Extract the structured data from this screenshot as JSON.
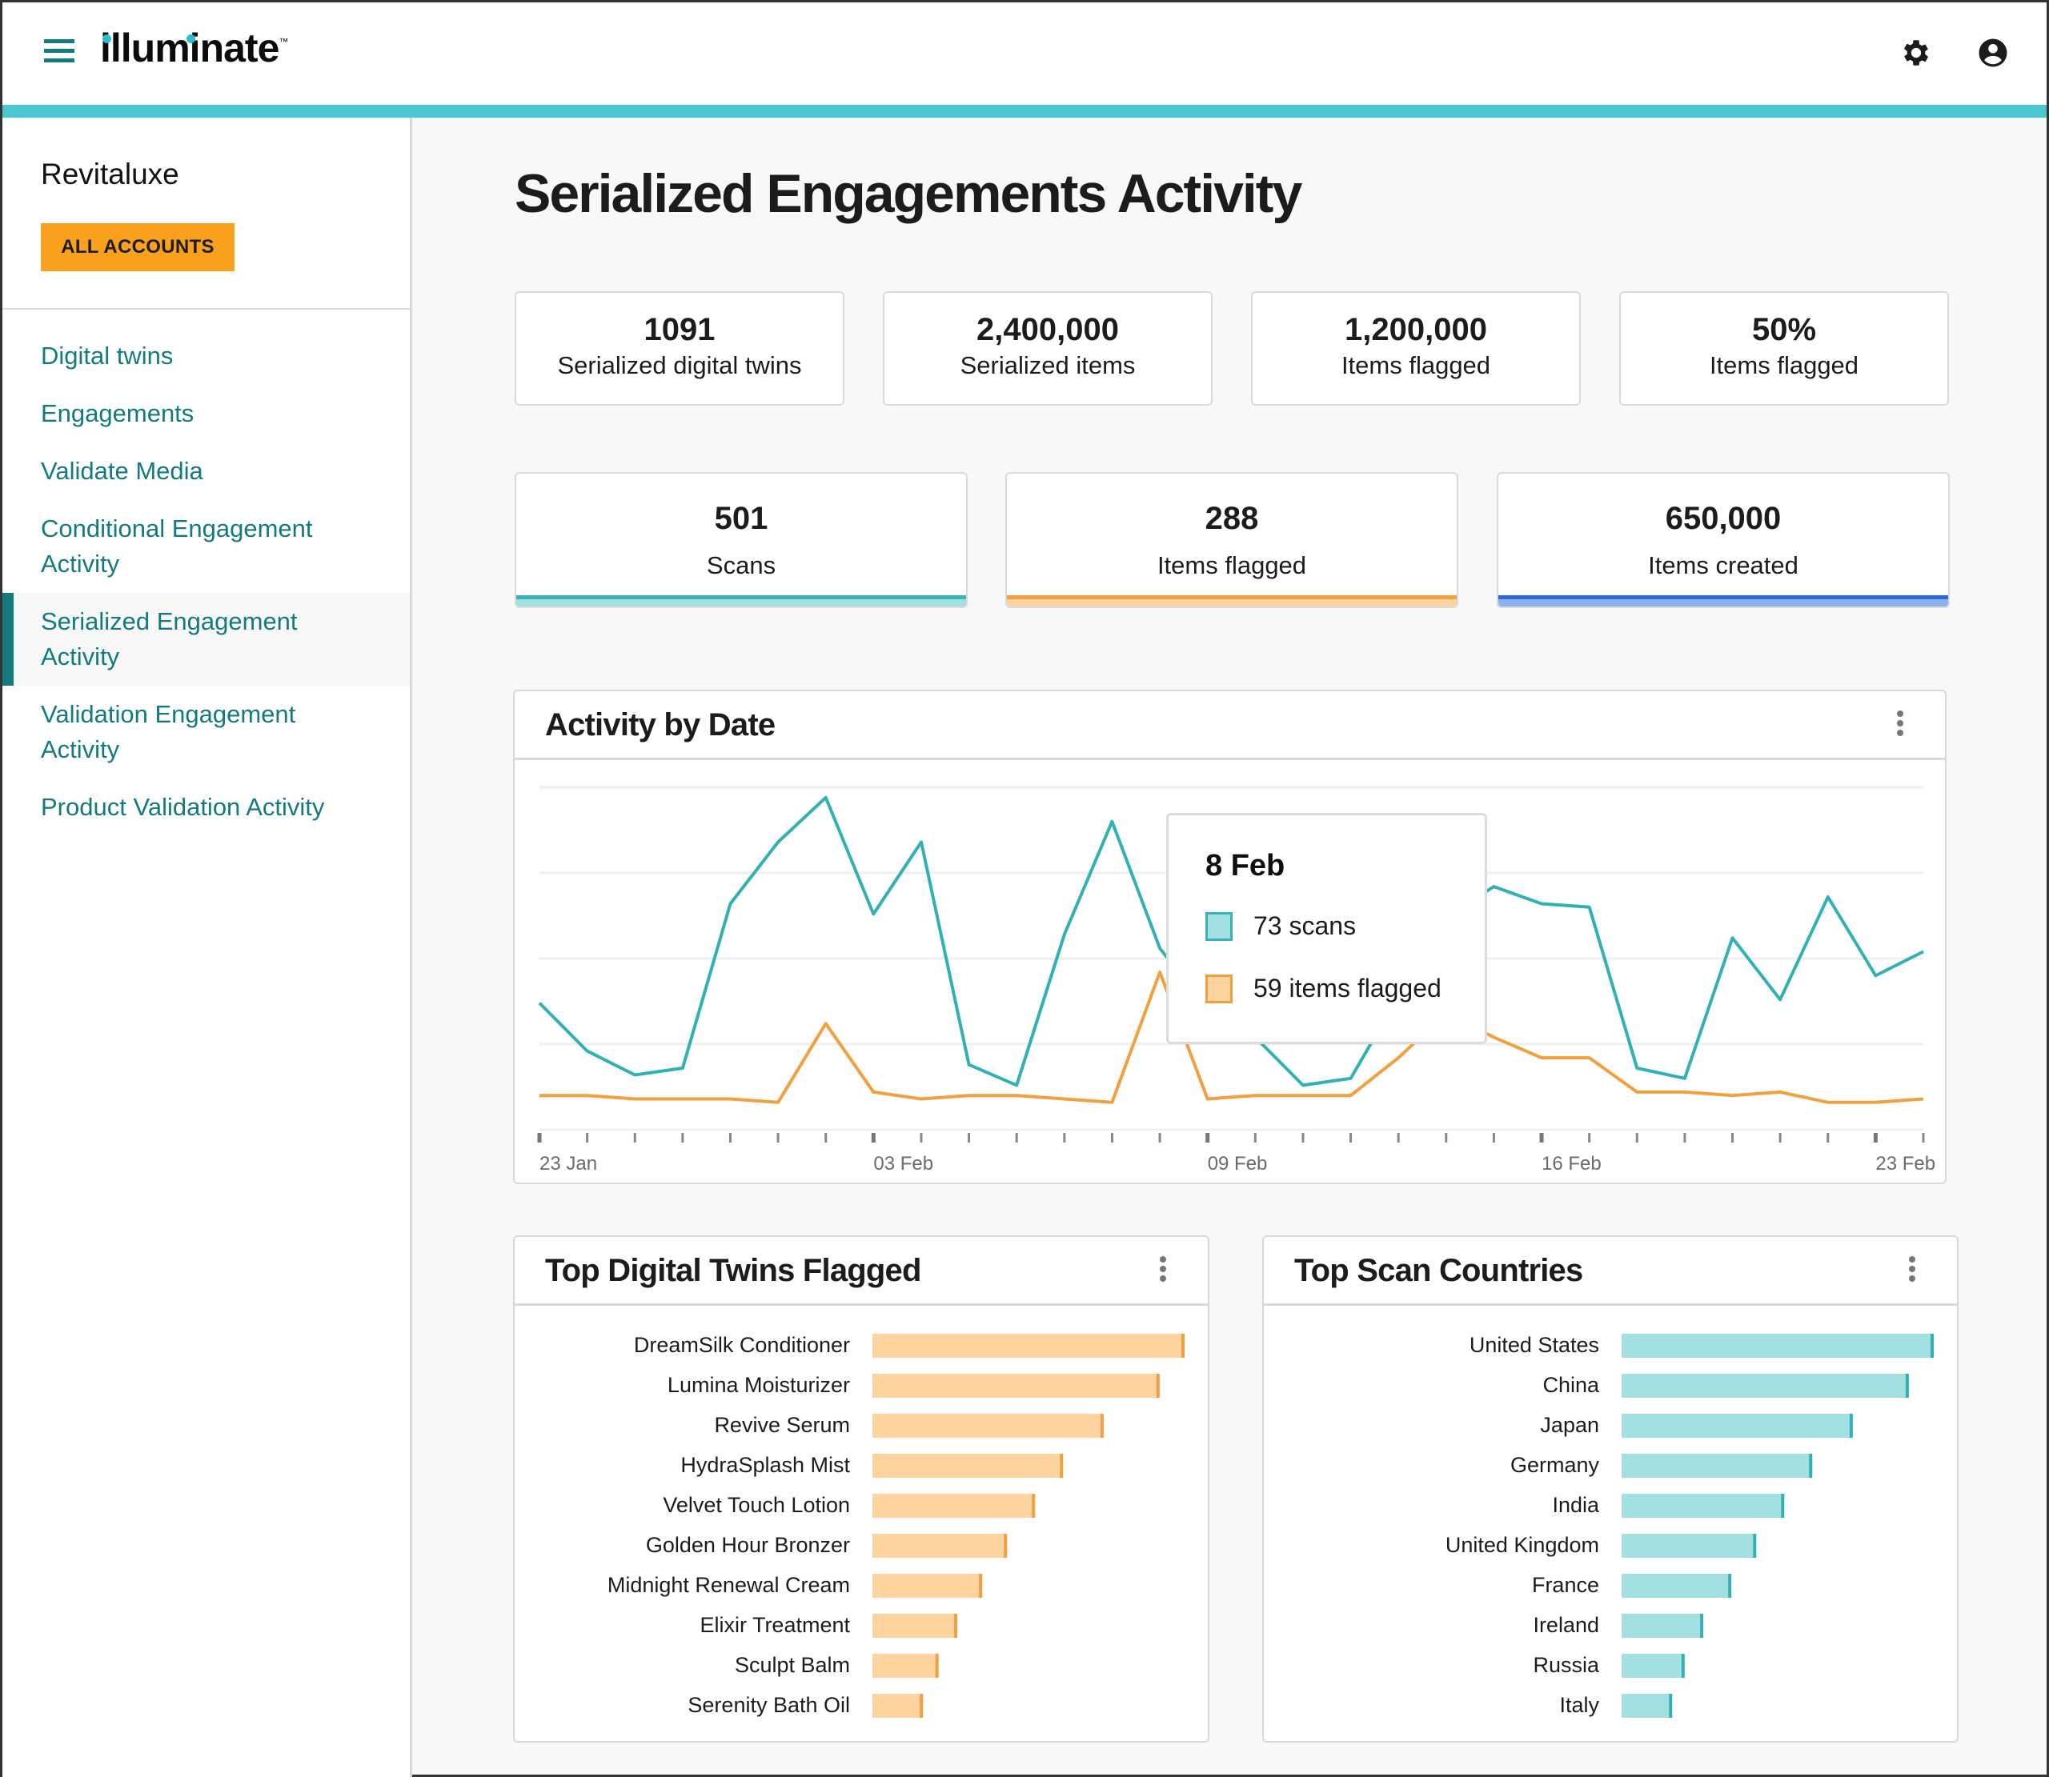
{
  "header": {
    "logo_text": "illuminate",
    "logo_tm": "™",
    "menu_icon": "hamburger-menu-icon",
    "settings_icon": "gear-icon",
    "account_icon": "account-circle-icon",
    "accent_color": "#4ac8cf"
  },
  "sidebar": {
    "account_name": "Revitaluxe",
    "all_accounts_label": "ALL ACCOUNTS",
    "items": [
      {
        "label": "Digital twins",
        "active": false
      },
      {
        "label": "Engagements",
        "active": false
      },
      {
        "label": "Validate Media",
        "active": false
      },
      {
        "label": "Conditional Engagement Activity",
        "active": false
      },
      {
        "label": "Serialized Engagement Activity",
        "active": true
      },
      {
        "label": "Validation Engagement Activity",
        "active": false
      },
      {
        "label": "Product Validation Activity",
        "active": false
      }
    ]
  },
  "main": {
    "title": "Serialized Engagements Activity",
    "kpis_row1": [
      {
        "value": "1091",
        "label": "Serialized digital twins"
      },
      {
        "value": "2,400,000",
        "label": "Serialized items"
      },
      {
        "value": "1,200,000",
        "label": "Items flagged"
      },
      {
        "value": "50%",
        "label": "Items flagged"
      }
    ],
    "kpis_row2": [
      {
        "value": "501",
        "label": "Scans",
        "color": "#3ab3b8",
        "light": "#a3e0e2"
      },
      {
        "value": "288",
        "label": "Items flagged",
        "color": "#f0a040",
        "light": "#fcd3a0"
      },
      {
        "value": "650,000",
        "label": "Items created",
        "color": "#2a66d4",
        "light": "#8fb0ec"
      }
    ]
  },
  "activity_card": {
    "title": "Activity by Date",
    "menu_icon": "more-vertical-icon",
    "tooltip": {
      "date": "8 Feb",
      "rows": [
        {
          "text": "73 scans",
          "fill": "#a3e0e2",
          "stroke": "#3ab3b8"
        },
        {
          "text": "59 items flagged",
          "fill": "#fdd3a0",
          "stroke": "#f0a040"
        }
      ]
    }
  },
  "twins_card": {
    "title": "Top Digital Twins Flagged",
    "menu_icon": "more-vertical-icon"
  },
  "countries_card": {
    "title": "Top Scan Countries",
    "menu_icon": "more-vertical-icon"
  },
  "chart_data": [
    {
      "type": "line",
      "title": "Activity by Date",
      "x_tick_labels": [
        {
          "index": 0,
          "label": "23 Jan"
        },
        {
          "index": 7,
          "label": "03 Feb"
        },
        {
          "index": 14,
          "label": "09 Feb"
        },
        {
          "index": 21,
          "label": "16 Feb"
        },
        {
          "index": 28,
          "label": "23 Feb"
        }
      ],
      "point_count": 30,
      "ylim": [
        0,
        100
      ],
      "y_gridlines": [
        0,
        25,
        50,
        75,
        100
      ],
      "grid": true,
      "series": [
        {
          "name": "scans",
          "color": "#32b1b5",
          "values": [
            37,
            23,
            16,
            18,
            66,
            84,
            97,
            63,
            84,
            19,
            13,
            57,
            90,
            53,
            35,
            27,
            13,
            15,
            39,
            62,
            71,
            66,
            65,
            18,
            15,
            56,
            38,
            68,
            45,
            52
          ]
        },
        {
          "name": "items flagged",
          "color": "#f2a03d",
          "values": [
            10,
            10,
            9,
            9,
            9,
            8,
            31,
            11,
            9,
            10,
            10,
            9,
            8,
            46,
            9,
            10,
            10,
            10,
            21,
            34,
            27,
            21,
            21,
            11,
            11,
            10,
            11,
            8,
            8,
            9
          ]
        }
      ]
    },
    {
      "type": "bar",
      "orientation": "horizontal",
      "title": "Top Digital Twins Flagged",
      "categories": [
        "DreamSilk Conditioner",
        "Lumina Moisturizer",
        "Revive Serum",
        "HydraSplash Mist",
        "Velvet Touch Lotion",
        "Golden Hour Bronzer",
        "Midnight Renewal Cream",
        "Elixir Treatment",
        "Sculpt Balm",
        "Serenity Bath Oil"
      ],
      "values": [
        100,
        92,
        74,
        61,
        52,
        43,
        35,
        27,
        21,
        16
      ],
      "xlim": [
        0,
        100
      ],
      "fill": "#fdd3a0",
      "edge": "#f0a040"
    },
    {
      "type": "bar",
      "orientation": "horizontal",
      "title": "Top Scan Countries",
      "categories": [
        "United States",
        "China",
        "Japan",
        "Germany",
        "India",
        "United Kingdom",
        "France",
        "Ireland",
        "Russia",
        "Italy"
      ],
      "values": [
        100,
        92,
        74,
        61,
        52,
        43,
        35,
        26,
        20,
        16
      ],
      "xlim": [
        0,
        100
      ],
      "fill": "#a3e0e2",
      "edge": "#32b1b5"
    }
  ]
}
